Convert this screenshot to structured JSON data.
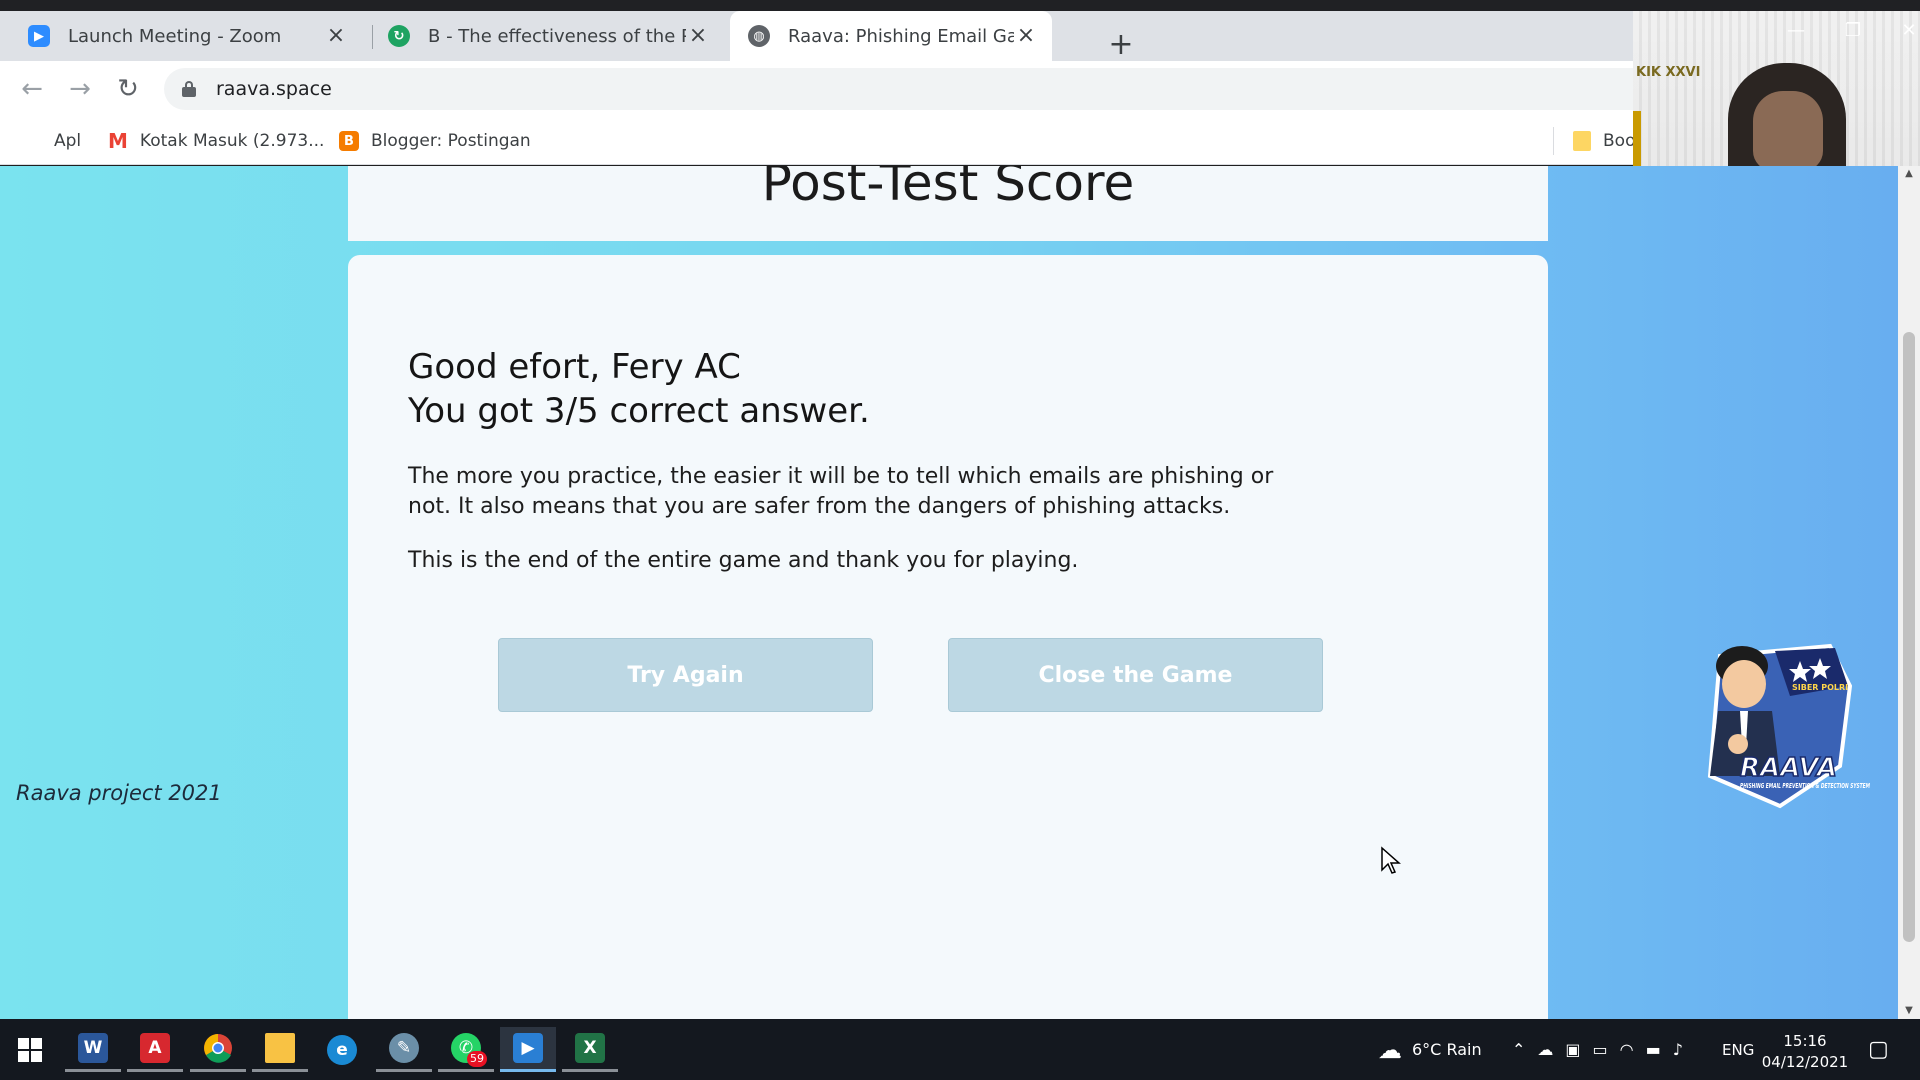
{
  "browser": {
    "tabs": [
      {
        "title": "Launch Meeting - Zoom",
        "icon": "zoom-icon"
      },
      {
        "title": "B - The effectiveness of the Phish",
        "icon": "shared-doc-icon"
      },
      {
        "title": "Raava: Phishing Email Game",
        "icon": "globe-icon"
      }
    ],
    "url": "raava.space",
    "bookmarks": [
      {
        "label": "Apl",
        "icon": "apps-grid-icon"
      },
      {
        "label": "Kotak Masuk (2.973...",
        "icon": "gmail-icon"
      },
      {
        "label": "Blogger: Postingan",
        "icon": "blogger-icon"
      },
      {
        "label": "Boo",
        "icon": "folder-icon"
      }
    ]
  },
  "webcam": {
    "poster_text": "KIK XXVI"
  },
  "page": {
    "header_title": "Post-Test Score",
    "greeting_line1": "Good efort, Fery AC",
    "greeting_line2": "You got 3/5 correct answer.",
    "paragraph1": "The more you practice, the easier it will be to tell which emails are phishing or not. It also means that you are safer from the dangers of phishing attacks.",
    "paragraph2": "This is the end of the entire game and thank you for playing.",
    "try_again_label": "Try Again",
    "close_game_label": "Close the Game",
    "footer": "Raava project 2021",
    "mascot_text_1": "RAAVA",
    "mascot_text_2": "PHISHING EMAIL PREVENTION & DETECTION SYSTEM",
    "mascot_text_3": "SIBER POLRI"
  },
  "taskbar": {
    "weather": "6°C  Rain",
    "language": "ENG",
    "time": "15:16",
    "date": "04/12/2021",
    "whatsapp_badge": "59",
    "apps": [
      "start-icon",
      "word-icon",
      "acrobat-icon",
      "chrome-icon",
      "file-explorer-icon",
      "edge-icon",
      "paint-icon",
      "whatsapp-icon",
      "media-player-icon",
      "excel-icon"
    ]
  },
  "colors": {
    "page_bg_left": "#7ae3ef",
    "page_bg_right": "#68aef0",
    "button_bg": "#bdd8e4",
    "card_bg": "#f4f9fc"
  }
}
